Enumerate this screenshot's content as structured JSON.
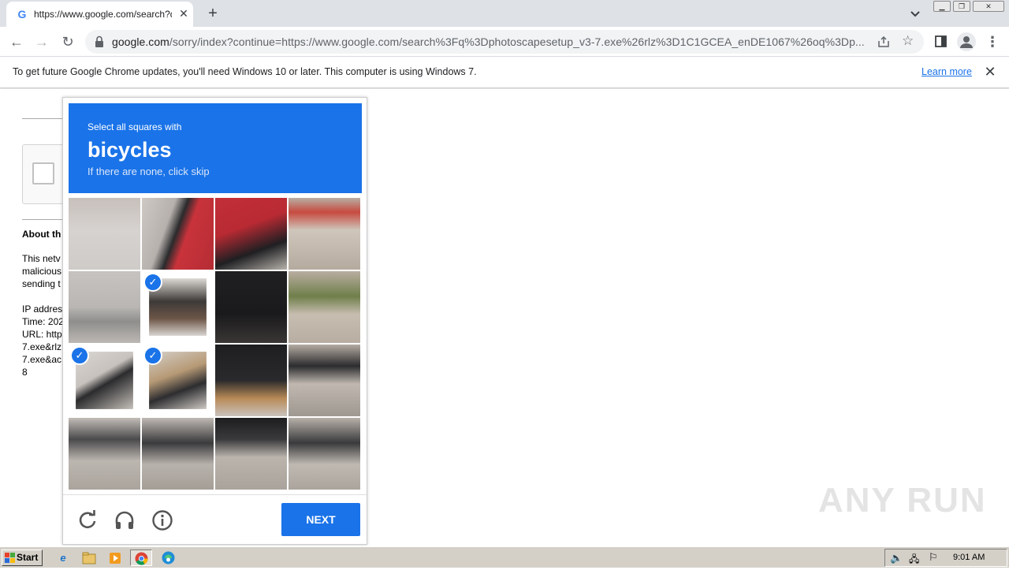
{
  "browser": {
    "tab_title": "https://www.google.com/search?q=",
    "tab_favicon": "G",
    "tab_close": "✕",
    "new_tab": "+",
    "url_host": "google.com",
    "url_rest": "/sorry/index?continue=https://www.google.com/search%3Fq%3Dphotoscapesetup_v3-7.exe%26rlz%3D1C1GCEA_enDE1067%26oq%3Dp..."
  },
  "infobar": {
    "message": "To get future Google Chrome updates, you'll need Windows 10 or later. This computer is using Windows 7.",
    "link": "Learn more",
    "close": "✕"
  },
  "page": {
    "about_heading": "About th",
    "para_lines": [
      "This netv",
      "malicious",
      "sending t"
    ],
    "detail_lines": [
      "IP addres",
      "Time: 202",
      "URL: http",
      "7.exe&rlz",
      "7.exe&ac",
      "8"
    ]
  },
  "captcha": {
    "prompt": "Select all squares with",
    "target": "bicycles",
    "hint": "If there are none, click skip",
    "next_label": "NEXT",
    "selected_tiles": [
      5,
      8,
      9
    ],
    "header_color": "#1a73e8"
  },
  "watermark": "ANY RUN",
  "taskbar": {
    "start_label": "Start",
    "clock": "9:01 AM"
  }
}
